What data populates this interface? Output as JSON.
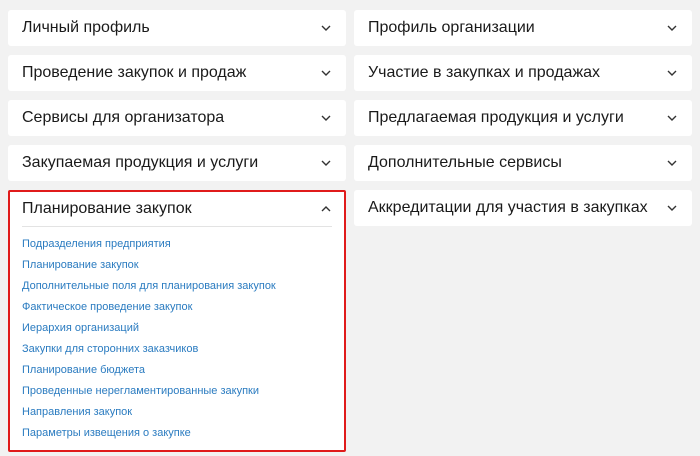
{
  "left_column": {
    "cards": [
      {
        "title": "Личный профиль"
      },
      {
        "title": "Проведение закупок и продаж"
      },
      {
        "title": "Сервисы для организатора"
      },
      {
        "title": "Закупаемая продукция и услуги"
      }
    ],
    "expanded_card": {
      "title": "Планирование закупок",
      "links": [
        "Подразделения предприятия",
        "Планирование закупок",
        "Дополнительные поля для планирования закупок",
        "Фактическое проведение закупок",
        "Иерархия организаций",
        "Закупки для сторонних заказчиков",
        "Планирование бюджета",
        "Проведенные нерегламентированные закупки",
        "Направления закупок",
        "Параметры извещения о закупке"
      ]
    }
  },
  "right_column": {
    "cards": [
      {
        "title": "Профиль организации"
      },
      {
        "title": "Участие в закупках и продажах"
      },
      {
        "title": "Предлагаемая продукция и услуги"
      },
      {
        "title": "Дополнительные сервисы"
      },
      {
        "title": "Аккредитации для участия в закупках"
      }
    ]
  },
  "colors": {
    "page_bg": "#f2f2f2",
    "card_bg": "#ffffff",
    "highlight_border": "#e01b1b",
    "link": "#2a7bc0",
    "title_text": "#1a1a1a"
  },
  "icons": {
    "collapsed": "chevron-down-icon",
    "expanded": "chevron-up-icon"
  }
}
